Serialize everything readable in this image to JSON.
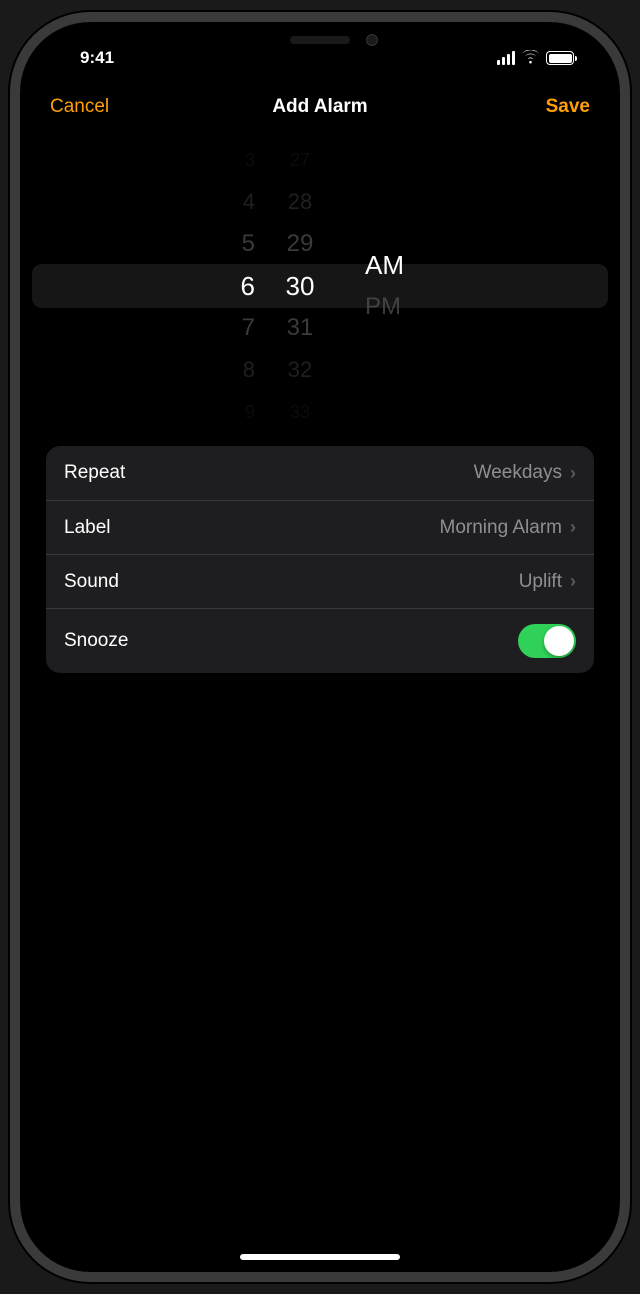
{
  "statusBar": {
    "time": "9:41"
  },
  "nav": {
    "cancel": "Cancel",
    "title": "Add Alarm",
    "save": "Save"
  },
  "picker": {
    "hours": [
      "3",
      "4",
      "5",
      "6",
      "7",
      "8",
      "9"
    ],
    "minutes": [
      "27",
      "28",
      "29",
      "30",
      "31",
      "32",
      "33"
    ],
    "periods": [
      "AM",
      "PM"
    ],
    "selectedHour": "6",
    "selectedMinute": "30",
    "selectedPeriod": "AM"
  },
  "settings": {
    "repeat": {
      "label": "Repeat",
      "value": "Weekdays"
    },
    "label": {
      "label": "Label",
      "value": "Morning Alarm"
    },
    "sound": {
      "label": "Sound",
      "value": "Uplift"
    },
    "snooze": {
      "label": "Snooze",
      "on": true
    }
  }
}
